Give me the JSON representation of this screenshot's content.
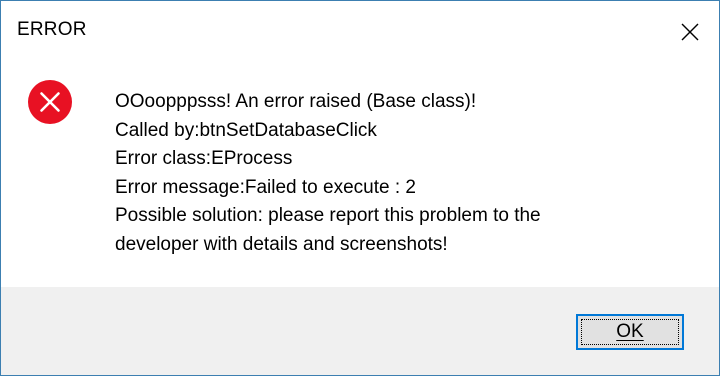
{
  "window": {
    "title": "ERROR"
  },
  "icons": {
    "close": "close-icon",
    "error": "error-icon",
    "error_color": "#e81123"
  },
  "message": {
    "lines": [
      "OOoopppsss! An error raised (Base class)!",
      "Called by:btnSetDatabaseClick",
      "Error class:EProcess",
      "Error message:Failed to execute  : 2",
      "Possible solution: please report this problem to the",
      "developer with details and screenshots!"
    ]
  },
  "buttons": {
    "ok_label": "OK"
  },
  "colors": {
    "accent": "#0078d7",
    "footer_bg": "#f0f0f0",
    "border": "#3c7fb1"
  }
}
